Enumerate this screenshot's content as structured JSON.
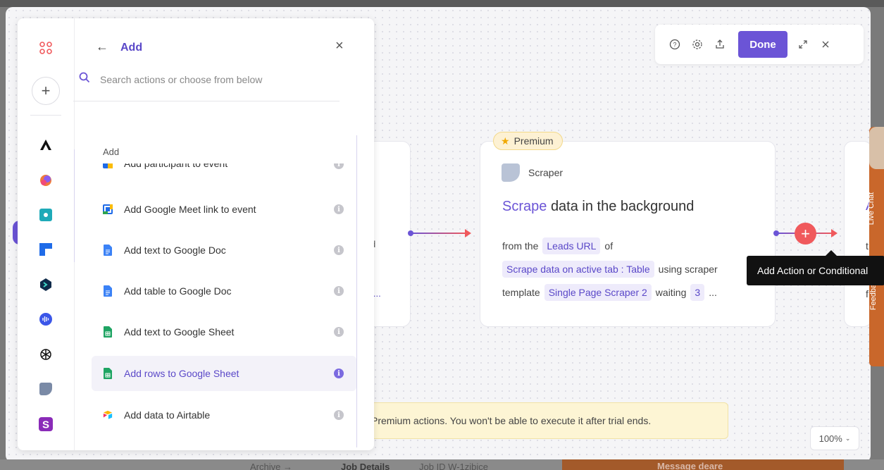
{
  "background": {
    "bottom_bar": {
      "archive": "Archive →",
      "job_details": "Job Details",
      "job_id": "Job ID W-1zibjce",
      "message": "Message deare"
    }
  },
  "toolbar": {
    "done_label": "Done"
  },
  "cards": {
    "left_fragments": [
      "d",
      "? ..."
    ],
    "premium_label": "Premium",
    "scraper_app": "Scraper",
    "title_highlight": "Scrape",
    "title_rest": "data in the background",
    "line1_prefix": "from the",
    "line1_chip": "Leads URL",
    "line1_suffix": "of",
    "line2_chip": "Scrape data on active tab : Table",
    "line2_suffix": "using scraper",
    "line3_prefix": "template",
    "line3_chip": "Single Page Scraper 2",
    "line3_suffix": "waiting",
    "line3_chip2": "3",
    "line3_ellipsis": "..."
  },
  "right_edge": {
    "fragments": [
      "A",
      "t",
      "f"
    ],
    "live_chat": "Live Chat",
    "feedback": "Feedback"
  },
  "tooltip": "Add Action or Conditional",
  "warning": "Premium actions. You won't be able to execute it after trial ends.",
  "zoom": {
    "level": "100%"
  },
  "panel": {
    "title": "Add",
    "search_placeholder": "Search actions or choose from below",
    "section_label": "Add",
    "items": [
      {
        "label": "Add participant to event",
        "icon": "google-calendar-icon",
        "partial": true
      },
      {
        "label": "Add Google Meet link to event",
        "icon": "google-calendar-icon"
      },
      {
        "label": "Add text to Google Doc",
        "icon": "google-docs-icon"
      },
      {
        "label": "Add table to Google Doc",
        "icon": "google-docs-icon"
      },
      {
        "label": "Add text to Google Sheet",
        "icon": "google-sheets-icon"
      },
      {
        "label": "Add rows to Google Sheet",
        "icon": "google-sheets-icon",
        "active": true
      },
      {
        "label": "Add data to Airtable",
        "icon": "airtable-icon"
      }
    ]
  },
  "colors": {
    "accent": "#6b54d6",
    "plus": "#f0595c",
    "premium_bg": "#fdf1d3",
    "warning_bg": "#fdf5d4"
  }
}
